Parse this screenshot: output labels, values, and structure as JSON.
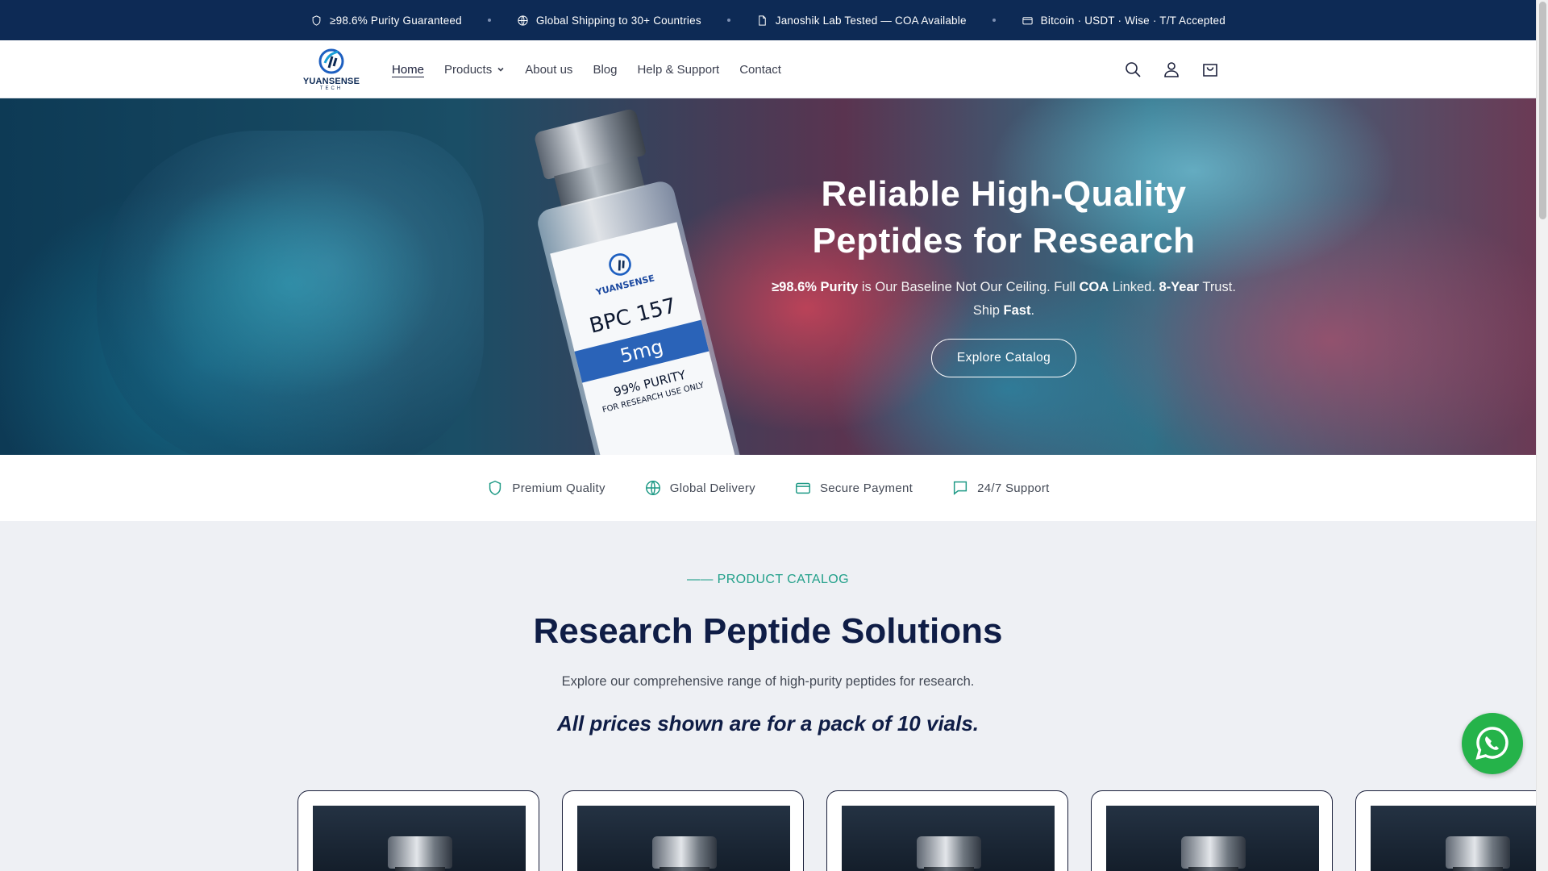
{
  "announcement": {
    "items": [
      {
        "icon": "shield-icon",
        "text": "≥98.6% Purity Guaranteed"
      },
      {
        "icon": "globe-icon",
        "text": "Global Shipping to 30+ Countries"
      },
      {
        "icon": "document-icon",
        "text": "Janoshik Lab Tested — COA Available"
      },
      {
        "icon": "card-icon",
        "text": "Bitcoin · USDT · Wise · T/T Accepted"
      }
    ]
  },
  "header": {
    "logo": {
      "brand": "YUANSENSE",
      "sub": "TECH"
    },
    "nav": [
      {
        "label": "Home",
        "active": true
      },
      {
        "label": "Products",
        "dropdown": true
      },
      {
        "label": "About us"
      },
      {
        "label": "Blog"
      },
      {
        "label": "Help & Support"
      },
      {
        "label": "Contact"
      }
    ],
    "icons": [
      "search-icon",
      "account-icon",
      "cart-icon"
    ]
  },
  "hero": {
    "title_line1": "Reliable High-Quality",
    "title_line2": "Peptides for Research",
    "subtitle": {
      "purity": "≥98.6% Purity",
      "t1": " is Our Baseline Not Our Ceiling. Full ",
      "coa": "COA",
      "t2": " Linked. ",
      "years": "8-Year",
      "t3": " Trust. Ship ",
      "fast": "Fast",
      "t4": "."
    },
    "button": "Explore Catalog",
    "vial": {
      "brand": "YUANSENSE",
      "name": "BPC 157",
      "dose": "5mg",
      "purity": "99% PURITY",
      "use": "FOR RESEARCH USE ONLY"
    }
  },
  "features": [
    {
      "icon": "shield-icon",
      "label": "Premium Quality"
    },
    {
      "icon": "globe-icon",
      "label": "Global Delivery"
    },
    {
      "icon": "card-icon",
      "label": "Secure Payment"
    },
    {
      "icon": "chat-icon",
      "label": "24/7 Support"
    }
  ],
  "catalog": {
    "eyebrow": "—— PRODUCT CATALOG",
    "title": "Research Peptide Solutions",
    "description": "Explore our comprehensive range of high-purity peptides for research.",
    "note": "All prices shown are for a pack of 10 vials."
  },
  "colors": {
    "topbar": "#0d2a55",
    "accent": "#1f9a86",
    "heading": "#0f1d46",
    "whatsapp": "#25b34a"
  }
}
